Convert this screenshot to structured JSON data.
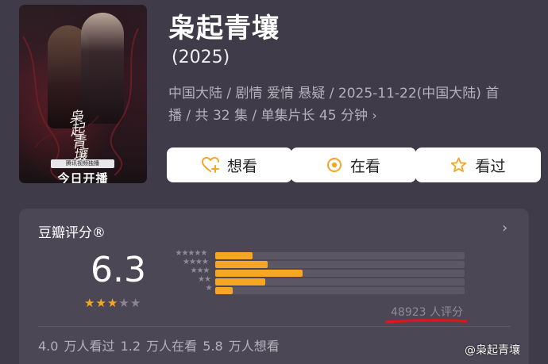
{
  "poster": {
    "title_art": "枭起青壤",
    "promo": "腾讯视频独播",
    "premiere": "今日开播"
  },
  "header": {
    "title": "枭起青壤",
    "year": "(2025)",
    "meta_line1": "中国大陆 / 剧情 爱情 悬疑 / 2025-11-22(中国大陆) 首",
    "meta_line2": "播 / 共 32 集 / 单集片长 45 分钟",
    "meta_chevron": "›"
  },
  "actions": {
    "want": {
      "label": "想看",
      "icon": "heart-plus-icon"
    },
    "watching": {
      "label": "在看",
      "icon": "target-icon"
    },
    "watched": {
      "label": "看过",
      "icon": "star-outline-icon"
    }
  },
  "rating": {
    "title": "豆瓣评分®",
    "score": "6.3",
    "stars_filled": 3,
    "stars_total": 5,
    "distribution_stars": [
      5,
      4,
      3,
      2,
      1
    ],
    "distribution_fractions": [
      0.15,
      0.21,
      0.35,
      0.2,
      0.07
    ],
    "count": "48923 人评分",
    "stats": "4.0 万人看过    1.2 万人在看    5.8 万人想看",
    "chevron": "›"
  },
  "colors": {
    "background": "#3f3b49",
    "card": "#4b4755",
    "accent": "#f5a623",
    "button": "#ffffff",
    "annotation_red": "#e0141c"
  },
  "watermark": "@枭起青壤"
}
